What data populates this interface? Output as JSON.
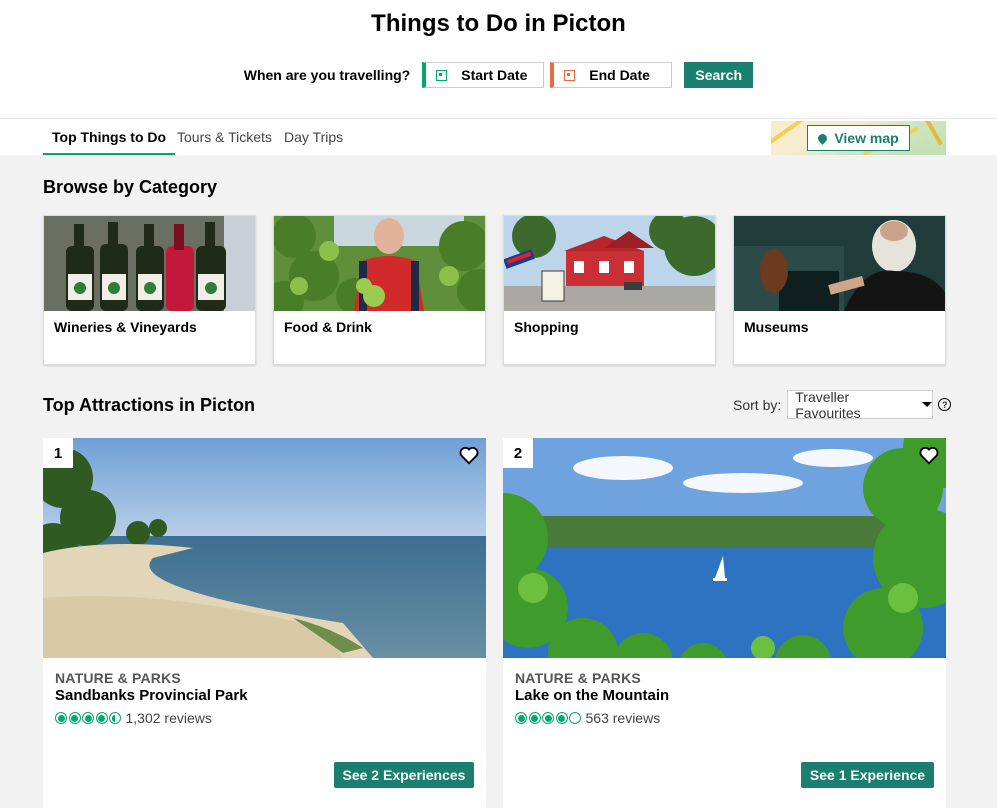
{
  "page_title": "Things to Do in Picton",
  "travel": {
    "question": "When are you travelling?",
    "start_label": "Start Date",
    "end_label": "End Date",
    "search_label": "Search"
  },
  "tabs": [
    {
      "label": "Top Things to Do",
      "active": true
    },
    {
      "label": "Tours & Tickets",
      "active": false
    },
    {
      "label": "Day Trips",
      "active": false
    }
  ],
  "view_map_label": "View map",
  "browse_title": "Browse by Category",
  "categories": [
    {
      "label": "Wineries & Vineyards"
    },
    {
      "label": "Food & Drink"
    },
    {
      "label": "Shopping"
    },
    {
      "label": "Museums"
    }
  ],
  "top_attractions_title": "Top Attractions in Picton",
  "sort": {
    "label": "Sort by:",
    "value": "Traveller Favourites",
    "help": "?"
  },
  "attractions": [
    {
      "rank": "1",
      "category": "NATURE & PARKS",
      "title": "Sandbanks Provincial Park",
      "rating": 4.5,
      "reviews": "1,302 reviews",
      "cta": "See 2 Experiences"
    },
    {
      "rank": "2",
      "category": "NATURE & PARKS",
      "title": "Lake on the Mountain",
      "rating": 4.0,
      "reviews": "563 reviews",
      "cta": "See 1 Experience"
    }
  ],
  "colors": {
    "accent": "#1a7f6e",
    "bubble": "#00aa6c",
    "start": "#00aa6c",
    "end": "#ef6945"
  },
  "icons": [
    "calendar-icon",
    "map-pin-icon",
    "heart-icon",
    "help-icon",
    "caret-down-icon",
    "rating-bubble-icon"
  ]
}
